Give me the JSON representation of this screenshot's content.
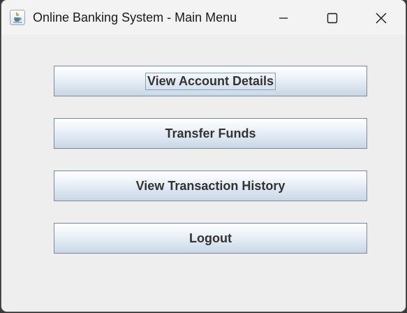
{
  "window": {
    "title": "Online Banking System - Main Menu",
    "icon": "java-cup-icon"
  },
  "controls": {
    "minimize_icon": "minimize-icon",
    "maximize_icon": "maximize-icon",
    "close_icon": "close-icon"
  },
  "menu": {
    "buttons": [
      {
        "label": "View Account Details",
        "focused": true
      },
      {
        "label": "Transfer Funds",
        "focused": false
      },
      {
        "label": "View Transaction History",
        "focused": false
      },
      {
        "label": "Logout",
        "focused": false
      }
    ]
  },
  "colors": {
    "button_border": "#7a8a99",
    "button_gradient_top": "#ffffff",
    "button_gradient_bottom": "#c8d6e5",
    "button_text": "#333333",
    "window_background": "#eeeeee"
  }
}
